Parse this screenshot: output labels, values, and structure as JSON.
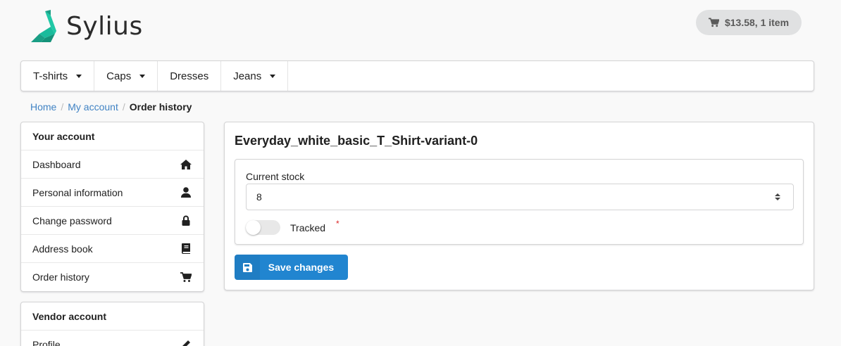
{
  "brand": {
    "name": "Sylius"
  },
  "cart": {
    "label": "$13.58, 1 item",
    "icon": "cart-icon"
  },
  "menu": {
    "items": [
      {
        "label": "T-shirts",
        "dropdown": true
      },
      {
        "label": "Caps",
        "dropdown": true
      },
      {
        "label": "Dresses",
        "dropdown": false
      },
      {
        "label": "Jeans",
        "dropdown": true
      }
    ]
  },
  "breadcrumb": {
    "home": "Home",
    "account": "My account",
    "current": "Order history",
    "separator": "/"
  },
  "sidebar": {
    "account": {
      "title": "Your account",
      "items": [
        {
          "label": "Dashboard",
          "icon": "home-icon"
        },
        {
          "label": "Personal information",
          "icon": "user-icon"
        },
        {
          "label": "Change password",
          "icon": "lock-icon"
        },
        {
          "label": "Address book",
          "icon": "book-icon"
        },
        {
          "label": "Order history",
          "icon": "cart-icon"
        }
      ]
    },
    "vendor": {
      "title": "Vendor account",
      "items": [
        {
          "label": "Profile",
          "icon": "pencil-icon"
        }
      ]
    }
  },
  "form": {
    "title": "Everyday_white_basic_T_Shirt-variant-0",
    "stock_label": "Current stock",
    "stock_value": "8",
    "tracked_label": "Tracked",
    "tracked_on": false,
    "required_mark": "*",
    "save_label": "Save changes"
  },
  "colors": {
    "primary": "#2185d0",
    "link": "#4183c4",
    "brand": "#1abb9c",
    "required": "#db2828"
  }
}
